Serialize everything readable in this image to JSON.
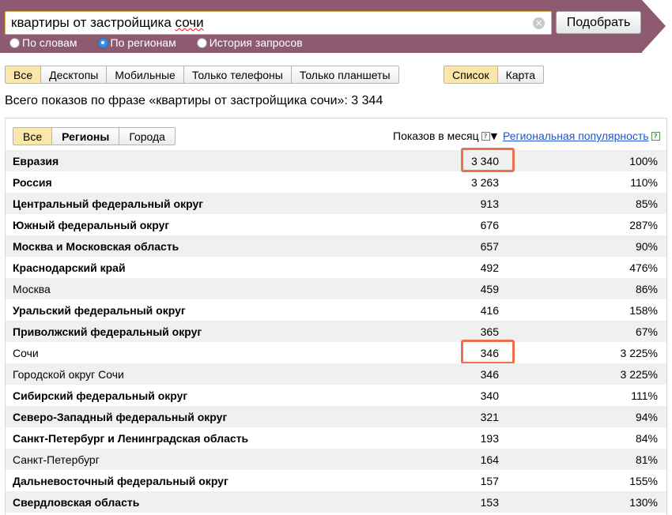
{
  "search": {
    "query_prefix": "квартиры от застройщика ",
    "query_misspelled": "сочи",
    "clear_glyph": "×",
    "button_label": "Подобрать"
  },
  "modes": [
    {
      "label": "По словам",
      "checked": false
    },
    {
      "label": "По регионам",
      "checked": true
    },
    {
      "label": "История запросов",
      "checked": false
    }
  ],
  "device_tabs": [
    "Все",
    "Десктопы",
    "Мобильные",
    "Только телефоны",
    "Только планшеты"
  ],
  "device_active": 0,
  "view_tabs": [
    "Список",
    "Карта"
  ],
  "view_active": 0,
  "total_text": "Всего показов по фразе «квартиры от застройщика сочи»: 3 344",
  "region_tabs": [
    "Все",
    "Регионы",
    "Города"
  ],
  "region_active": 0,
  "columns": {
    "shows": "Показов в месяц",
    "shows_help": "?",
    "sort_glyph": "▼",
    "popularity": "Региональная популярность",
    "popularity_help": "?"
  },
  "rows": [
    {
      "name": "Евразия",
      "bold": true,
      "shows": "3 340",
      "pop": "100%",
      "highlighted": true
    },
    {
      "name": "Россия",
      "bold": true,
      "shows": "3 263",
      "pop": "110%"
    },
    {
      "name": "Центральный федеральный округ",
      "bold": true,
      "shows": "913",
      "pop": "85%"
    },
    {
      "name": "Южный федеральный округ",
      "bold": true,
      "shows": "676",
      "pop": "287%"
    },
    {
      "name": "Москва и Московская область",
      "bold": true,
      "shows": "657",
      "pop": "90%"
    },
    {
      "name": "Краснодарский край",
      "bold": true,
      "shows": "492",
      "pop": "476%"
    },
    {
      "name": "Москва",
      "bold": false,
      "shows": "459",
      "pop": "86%"
    },
    {
      "name": "Уральский федеральный округ",
      "bold": true,
      "shows": "416",
      "pop": "158%"
    },
    {
      "name": "Приволжский федеральный округ",
      "bold": true,
      "shows": "365",
      "pop": "67%"
    },
    {
      "name": "Сочи",
      "bold": false,
      "shows": "346",
      "pop": "3 225%",
      "highlighted": true
    },
    {
      "name": "Городской округ Сочи",
      "bold": false,
      "shows": "346",
      "pop": "3 225%"
    },
    {
      "name": "Сибирский федеральный округ",
      "bold": true,
      "shows": "340",
      "pop": "111%"
    },
    {
      "name": "Северо-Западный федеральный округ",
      "bold": true,
      "shows": "321",
      "pop": "94%"
    },
    {
      "name": "Санкт-Петербург и Ленинградская область",
      "bold": true,
      "shows": "193",
      "pop": "84%"
    },
    {
      "name": "Санкт-Петербург",
      "bold": false,
      "shows": "164",
      "pop": "81%"
    },
    {
      "name": "Дальневосточный федеральный округ",
      "bold": true,
      "shows": "157",
      "pop": "155%"
    },
    {
      "name": "Свердловская область",
      "bold": true,
      "shows": "153",
      "pop": "130%"
    }
  ],
  "colors": {
    "band": "#8e5a72",
    "active_tab": "#fbe7a9",
    "highlight": "#f06e4e",
    "link": "#2255cc"
  }
}
